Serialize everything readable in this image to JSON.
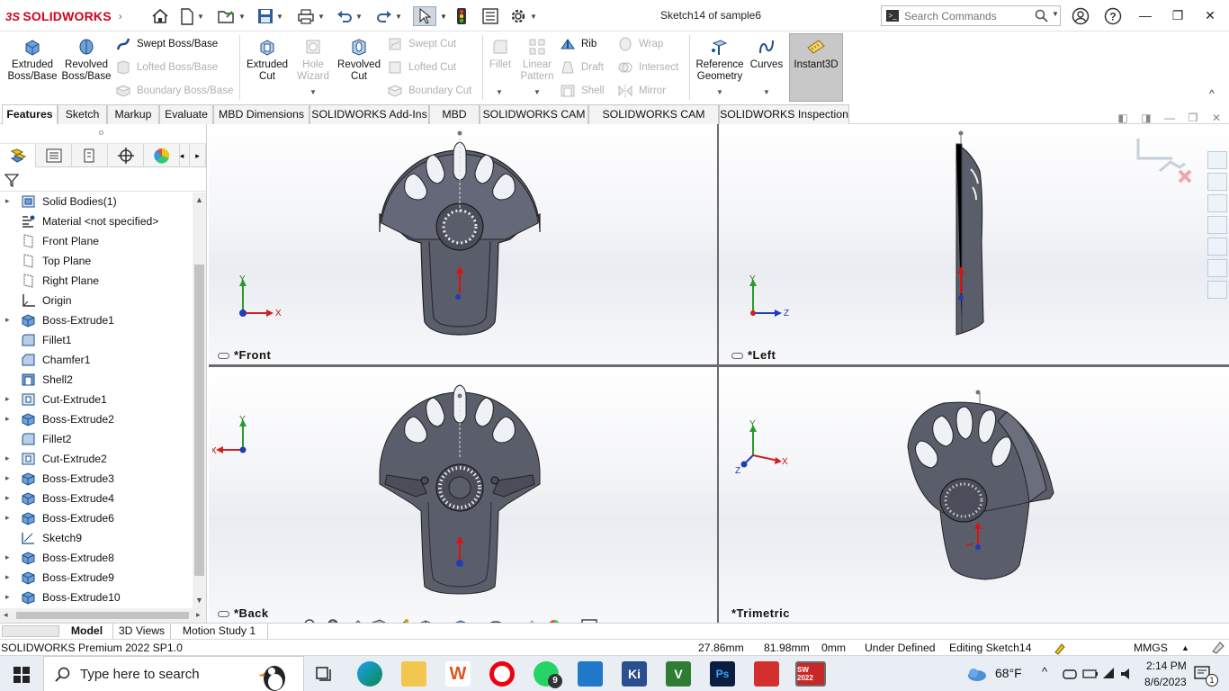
{
  "app": {
    "logo_text": "SOLIDWORKS",
    "logo_mark": "3S",
    "document_title": "Sketch14 of sample6"
  },
  "search": {
    "placeholder": "Search Commands"
  },
  "commands": {
    "extruded_boss": "Extruded Boss/Base",
    "revolved_boss": "Revolved Boss/Base",
    "swept_boss": "Swept Boss/Base",
    "lofted_boss": "Lofted Boss/Base",
    "boundary_boss": "Boundary Boss/Base",
    "extruded_cut": "Extruded Cut",
    "hole_wizard": "Hole Wizard",
    "revolved_cut": "Revolved Cut",
    "swept_cut": "Swept Cut",
    "lofted_cut": "Lofted Cut",
    "boundary_cut": "Boundary Cut",
    "fillet": "Fillet",
    "linear_pattern": "Linear Pattern",
    "rib": "Rib",
    "draft": "Draft",
    "shell": "Shell",
    "wrap": "Wrap",
    "intersect": "Intersect",
    "mirror": "Mirror",
    "reference_geometry": "Reference Geometry",
    "curves": "Curves",
    "instant3d": "Instant3D"
  },
  "tabs": [
    "Features",
    "Sketch",
    "Markup",
    "Evaluate",
    "MBD Dimensions",
    "SOLIDWORKS Add-Ins",
    "MBD",
    "SOLIDWORKS CAM",
    "SOLIDWORKS CAM TBM",
    "SOLIDWORKS Inspection"
  ],
  "tree": [
    {
      "label": "Solid Bodies(1)",
      "icon": "solid-bodies-icon",
      "expand": true
    },
    {
      "label": "Material <not specified>",
      "icon": "material-icon",
      "expand": false
    },
    {
      "label": "Front Plane",
      "icon": "plane-icon",
      "expand": false
    },
    {
      "label": "Top Plane",
      "icon": "plane-icon",
      "expand": false
    },
    {
      "label": "Right Plane",
      "icon": "plane-icon",
      "expand": false
    },
    {
      "label": "Origin",
      "icon": "origin-icon",
      "expand": false
    },
    {
      "label": "Boss-Extrude1",
      "icon": "boss-extrude-icon",
      "expand": true
    },
    {
      "label": "Fillet1",
      "icon": "fillet-icon",
      "expand": false
    },
    {
      "label": "Chamfer1",
      "icon": "chamfer-icon",
      "expand": false
    },
    {
      "label": "Shell2",
      "icon": "shell-icon",
      "expand": false
    },
    {
      "label": "Cut-Extrude1",
      "icon": "cut-extrude-icon",
      "expand": true
    },
    {
      "label": "Boss-Extrude2",
      "icon": "boss-extrude-icon",
      "expand": true
    },
    {
      "label": "Fillet2",
      "icon": "fillet-icon",
      "expand": false
    },
    {
      "label": "Cut-Extrude2",
      "icon": "cut-extrude-icon",
      "expand": true
    },
    {
      "label": "Boss-Extrude3",
      "icon": "boss-extrude-icon",
      "expand": true
    },
    {
      "label": "Boss-Extrude4",
      "icon": "boss-extrude-icon",
      "expand": true
    },
    {
      "label": "Boss-Extrude6",
      "icon": "boss-extrude-icon",
      "expand": true
    },
    {
      "label": "Sketch9",
      "icon": "sketch-icon",
      "expand": false
    },
    {
      "label": "Boss-Extrude8",
      "icon": "boss-extrude-icon",
      "expand": true
    },
    {
      "label": "Boss-Extrude9",
      "icon": "boss-extrude-icon",
      "expand": true
    },
    {
      "label": "Boss-Extrude10",
      "icon": "boss-extrude-icon",
      "expand": true
    }
  ],
  "viewports": {
    "front": "*Front",
    "left": "*Left",
    "back": "*Back",
    "trimetric": "*Trimetric"
  },
  "axes": {
    "x": "X",
    "y": "Y",
    "z": "Z"
  },
  "bottom_tabs": [
    "Model",
    "3D Views",
    "Motion Study 1"
  ],
  "status": {
    "product": "SOLIDWORKS Premium 2022 SP1.0",
    "x": "27.86mm",
    "y": "81.98mm",
    "z": "0mm",
    "state": "Under Defined",
    "editing": "Editing Sketch14",
    "units": "MMGS"
  },
  "taskbar": {
    "search_placeholder": "Type here to search",
    "whatsapp_badge": "9",
    "weather": "68°F",
    "time": "2:14 PM",
    "date": "8/6/2023",
    "notification_count": "1",
    "app_labels": {
      "word": "W",
      "kinovea": "Ki",
      "vbox": "V",
      "photoshop": "Ps",
      "solidworks": "SW 2022"
    }
  },
  "colors": {
    "brand": "#d0021b",
    "part": "#5a5d6a",
    "highlight": "#c8c8c8"
  }
}
